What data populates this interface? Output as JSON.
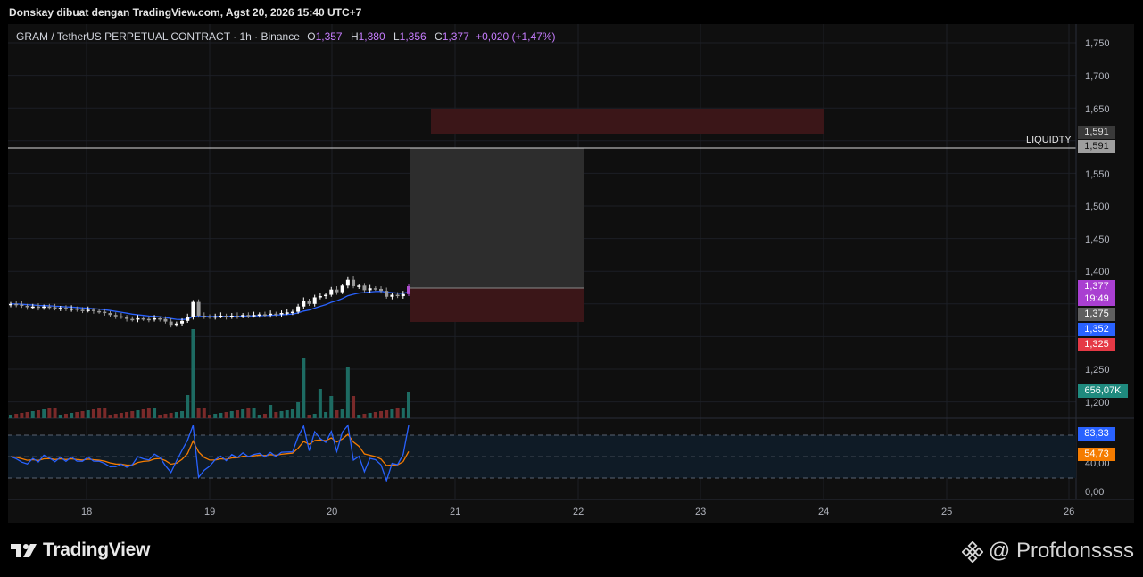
{
  "header": {
    "caption": "Donskay dibuat dengan TradingView.com, Agst 20, 2026 15:40 UTC+7"
  },
  "legend": {
    "symbol": "GRAM / TetherUS PERPETUAL CONTRACT · 1h · Binance",
    "o_label": "O",
    "o": "1,357",
    "h_label": "H",
    "h": "1,380",
    "l_label": "L",
    "l": "1,356",
    "c_label": "C",
    "c": "1,377",
    "change": "+0,020 (+1,47%)"
  },
  "price_axis": {
    "ticks": [
      "1,750",
      "1,700",
      "1,650",
      "1,550",
      "1,500",
      "1,450",
      "1,400",
      "1,250",
      "1,200"
    ]
  },
  "rsi_axis": {
    "ticks": [
      "40,00",
      "0,00"
    ]
  },
  "time_axis": {
    "ticks": [
      "18",
      "19",
      "20",
      "21",
      "22",
      "23",
      "24",
      "25",
      "26"
    ]
  },
  "liquidity": {
    "label": "LIQUIDTY",
    "price_a": "1,591",
    "price_b": "1,591"
  },
  "price_tags": {
    "last": "1,377",
    "countdown": "19:49",
    "tag_1375": "1,375",
    "tag_1352": "1,352",
    "tag_1325": "1,325",
    "volume": "656,07K",
    "rsi": "83,33",
    "rsi_ma": "54,73"
  },
  "colors": {
    "up": "#26a69a",
    "down": "#ef5350",
    "last_price": "#b04fd0",
    "ma_line": "#2962ff",
    "rsi_line": "#2962ff",
    "rsi_ma_line": "#f57c00",
    "supply_zone": "#3b1618",
    "target_zone": "#2d2d2d"
  },
  "branding": {
    "logo_text": "TradingView",
    "logo_icon": "tradingview-logo-icon",
    "watermark": "@ Profdonssss",
    "watermark_icon": "binance-icon"
  },
  "chart_data": {
    "type": "candlestick",
    "symbol": "GRAMUSDT.P",
    "interval": "1h",
    "ohlc_last": {
      "open": 1.357,
      "high": 1.38,
      "low": 1.356,
      "close": 1.377
    },
    "price_range": [
      1.17,
      1.77
    ],
    "zones": [
      {
        "kind": "supply",
        "from_price": 1.613,
        "to_price": 1.65,
        "from_day": 20.8,
        "to_day": 24.0
      },
      {
        "kind": "target",
        "from_price": 1.377,
        "to_price": 1.591,
        "from_day": 20.65,
        "to_day": 22.05
      },
      {
        "kind": "stop",
        "from_price": 1.325,
        "to_price": 1.377,
        "from_day": 20.65,
        "to_day": 22.05
      }
    ],
    "horizontal_line": {
      "price": 1.591,
      "label": "LIQUIDTY"
    },
    "close_series": [
      1.35,
      1.349,
      1.347,
      1.345,
      1.346,
      1.344,
      1.346,
      1.345,
      1.343,
      1.344,
      1.342,
      1.343,
      1.341,
      1.34,
      1.341,
      1.339,
      1.338,
      1.336,
      1.333,
      1.331,
      1.33,
      1.327,
      1.326,
      1.328,
      1.327,
      1.326,
      1.328,
      1.327,
      1.323,
      1.318,
      1.32,
      1.324,
      1.33,
      1.353,
      1.332,
      1.331,
      1.33,
      1.331,
      1.332,
      1.33,
      1.332,
      1.331,
      1.333,
      1.332,
      1.333,
      1.334,
      1.333,
      1.335,
      1.334,
      1.336,
      1.337,
      1.338,
      1.346,
      1.355,
      1.35,
      1.36,
      1.362,
      1.364,
      1.372,
      1.368,
      1.378,
      1.387,
      1.377,
      1.378,
      1.371,
      1.374,
      1.373,
      1.37,
      1.361,
      1.364,
      1.362,
      1.365,
      1.377
    ],
    "rsi": {
      "value": 83.33,
      "ma": 54.73,
      "bands": [
        70,
        50,
        30
      ]
    }
  }
}
